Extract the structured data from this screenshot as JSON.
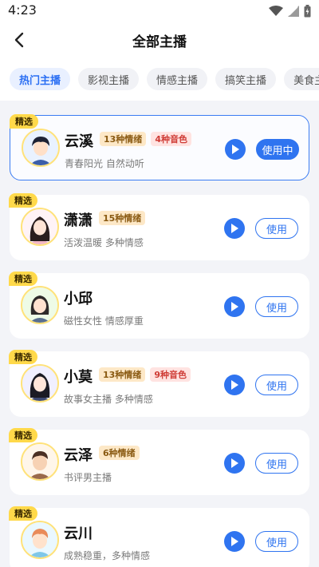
{
  "status_bar": {
    "time": "4:23"
  },
  "header": {
    "title": "全部主播"
  },
  "tabs": [
    {
      "label": "热门主播",
      "active": true
    },
    {
      "label": "影视主播",
      "active": false
    },
    {
      "label": "情感主播",
      "active": false
    },
    {
      "label": "搞笑主播",
      "active": false
    },
    {
      "label": "美食主播",
      "active": false
    }
  ],
  "anchors": [
    {
      "badge": "精选",
      "name": "云溪",
      "tags": [
        "13种情绪",
        "4种音色"
      ],
      "desc": "青春阳光 自然动听",
      "button": "使用中",
      "selected": true
    },
    {
      "badge": "精选",
      "name": "潇潇",
      "tags": [
        "15种情绪"
      ],
      "desc": "活泼温暖 多种情感",
      "button": "使用",
      "selected": false
    },
    {
      "badge": "精选",
      "name": "小邱",
      "tags": [],
      "desc": "磁性女性 情感厚重",
      "button": "使用",
      "selected": false
    },
    {
      "badge": "精选",
      "name": "小莫",
      "tags": [
        "13种情绪",
        "9种音色"
      ],
      "desc": "故事女主播 多种情感",
      "button": "使用",
      "selected": false
    },
    {
      "badge": "精选",
      "name": "云泽",
      "tags": [
        "6种情绪"
      ],
      "desc": "书评男主播",
      "button": "使用",
      "selected": false
    },
    {
      "badge": "精选",
      "name": "云川",
      "tags": [],
      "desc": "成熟稳重，多种情感",
      "button": "使用",
      "selected": false
    }
  ],
  "colors": {
    "accent": "#2f74f0",
    "badge": "#ffd94a",
    "emotion_tag_bg": "#fde8c7",
    "voice_tag_bg": "#ffe3e1"
  }
}
